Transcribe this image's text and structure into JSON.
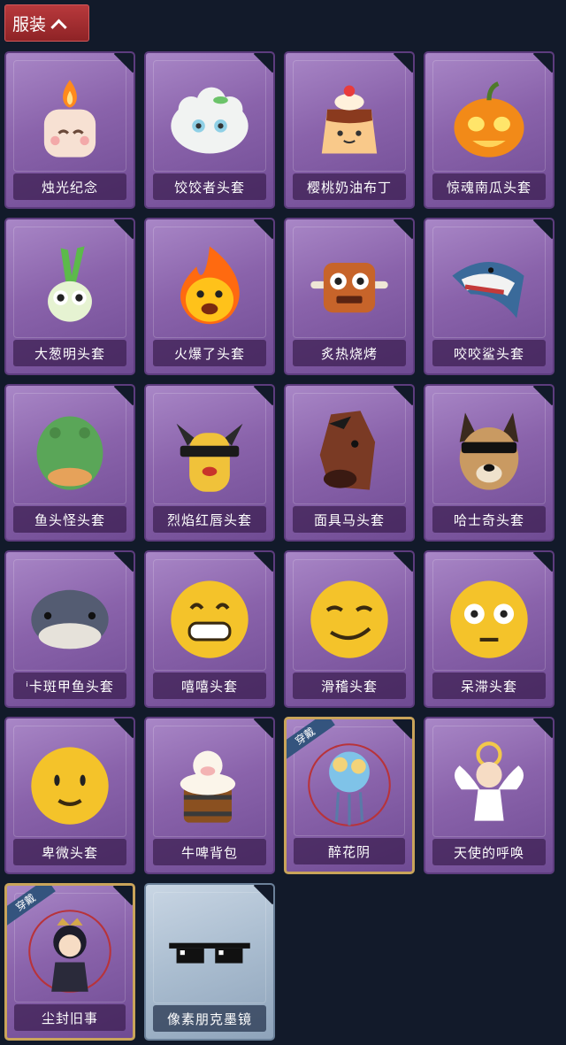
{
  "header": {
    "label": "服装"
  },
  "items": [
    {
      "name": "烛光纪念",
      "icon": "candle-icon"
    },
    {
      "name": "饺饺者头套",
      "icon": "dumpling-icon"
    },
    {
      "name": "樱桃奶油布丁",
      "icon": "pudding-icon"
    },
    {
      "name": "惊魂南瓜头套",
      "icon": "pumpkin-icon"
    },
    {
      "name": "大葱明头套",
      "icon": "scallion-icon"
    },
    {
      "name": "火爆了头套",
      "icon": "fireball-icon"
    },
    {
      "name": "炙热烧烤",
      "icon": "barbecue-icon"
    },
    {
      "name": "咬咬鲨头套",
      "icon": "shark-icon"
    },
    {
      "name": "鱼头怪头套",
      "icon": "fish-head-icon"
    },
    {
      "name": "烈焰红唇头套",
      "icon": "yellow-mascot-icon"
    },
    {
      "name": "面具马头套",
      "icon": "horse-mask-icon"
    },
    {
      "name": "哈士奇头套",
      "icon": "husky-icon"
    },
    {
      "name": "ⁱ卡斑甲鱼头套",
      "icon": "fish-icon"
    },
    {
      "name": "嘻嘻头套",
      "icon": "grin-emoji-icon"
    },
    {
      "name": "滑稽头套",
      "icon": "smirk-emoji-icon"
    },
    {
      "name": "呆滞头套",
      "icon": "stare-emoji-icon"
    },
    {
      "name": "卑微头套",
      "icon": "humble-emoji-icon"
    },
    {
      "name": "牛啤背包",
      "icon": "cow-beer-icon"
    },
    {
      "name": "醉花阴",
      "icon": "flower-ornament-icon",
      "badge": "穿戴"
    },
    {
      "name": "天使的呼唤",
      "icon": "angel-icon"
    },
    {
      "name": "尘封旧事",
      "icon": "chibi-character-icon",
      "badge": "穿戴"
    },
    {
      "name": "像素朋克墨镜",
      "icon": "pixel-sunglasses-icon"
    }
  ]
}
